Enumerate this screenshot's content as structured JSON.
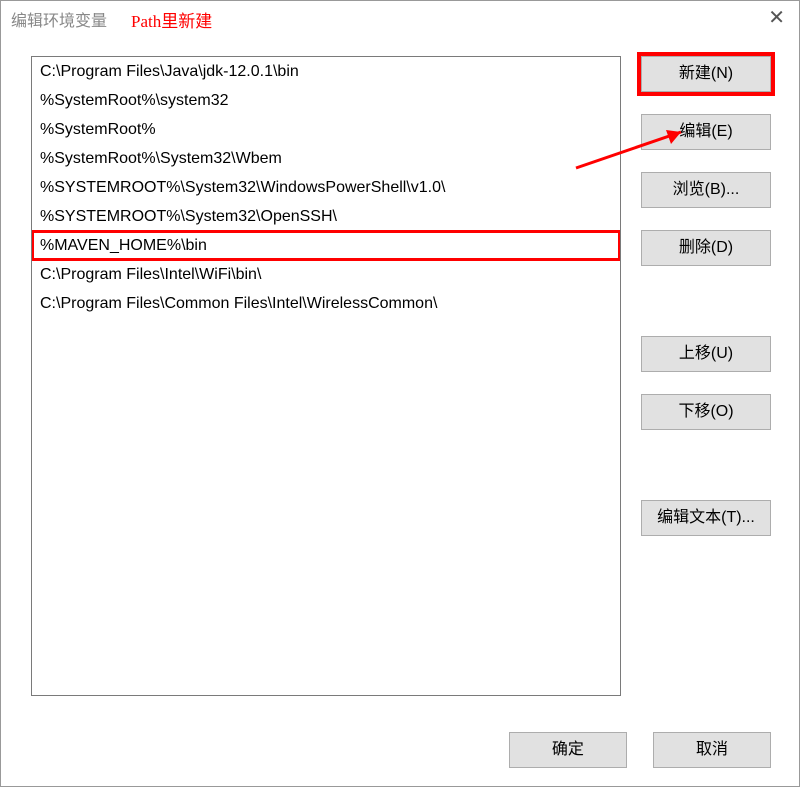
{
  "window": {
    "title": "编辑环境变量",
    "close_glyph": "✕"
  },
  "annotation": "Path里新建",
  "path_entries": [
    "C:\\Program Files\\Java\\jdk-12.0.1\\bin",
    "%SystemRoot%\\system32",
    "%SystemRoot%",
    "%SystemRoot%\\System32\\Wbem",
    "%SYSTEMROOT%\\System32\\WindowsPowerShell\\v1.0\\",
    "%SYSTEMROOT%\\System32\\OpenSSH\\",
    "%MAVEN_HOME%\\bin",
    "C:\\Program Files\\Intel\\WiFi\\bin\\",
    "C:\\Program Files\\Common Files\\Intel\\WirelessCommon\\"
  ],
  "highlighted_index": 6,
  "buttons": {
    "new": "新建(N)",
    "edit": "编辑(E)",
    "browse": "浏览(B)...",
    "delete": "删除(D)",
    "move_up": "上移(U)",
    "move_down": "下移(O)",
    "edit_text": "编辑文本(T)..."
  },
  "footer": {
    "ok": "确定",
    "cancel": "取消"
  }
}
